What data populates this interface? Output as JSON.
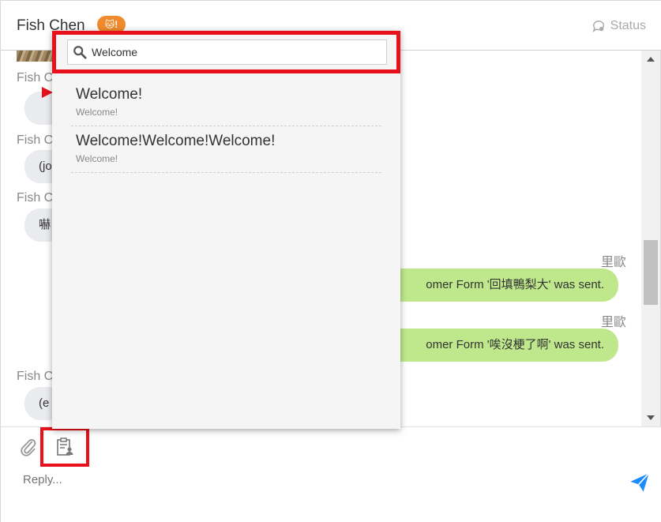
{
  "header": {
    "contact_name": "Fish Chen",
    "badge": "🐱!",
    "status_label": "Status"
  },
  "chat": {
    "messages": [
      {
        "side": "in",
        "sender": "Fish C",
        "text": ""
      },
      {
        "side": "in",
        "sender": "Fish C",
        "text": "(jo"
      },
      {
        "side": "in",
        "sender": "Fish C",
        "text": "嚇"
      },
      {
        "side": "out",
        "sender": "里歐",
        "text": "omer Form '回填鴨梨大' was sent."
      },
      {
        "side": "out",
        "sender": "里歐",
        "text": "omer Form '唉沒梗了啊' was sent."
      },
      {
        "side": "in",
        "sender": "Fish C",
        "text": "(e"
      }
    ]
  },
  "popup": {
    "search_value": "Welcome",
    "results": [
      {
        "title": "Welcome!",
        "subtitle": "Welcome!"
      },
      {
        "title": "Welcome!Welcome!Welcome!",
        "subtitle": "Welcome!"
      }
    ]
  },
  "composer": {
    "placeholder": "Reply..."
  },
  "colors": {
    "highlight_red": "#e8101a",
    "badge_orange": "#f08a2c",
    "bubble_out_green": "#bfe88c",
    "bubble_in_gray": "#e9ebee",
    "send_blue": "#1a8cff"
  },
  "icons": {
    "status": "chat-status-icon",
    "attach": "paperclip-icon",
    "form": "clipboard-form-icon",
    "send": "paper-plane-icon",
    "search": "search-icon"
  }
}
